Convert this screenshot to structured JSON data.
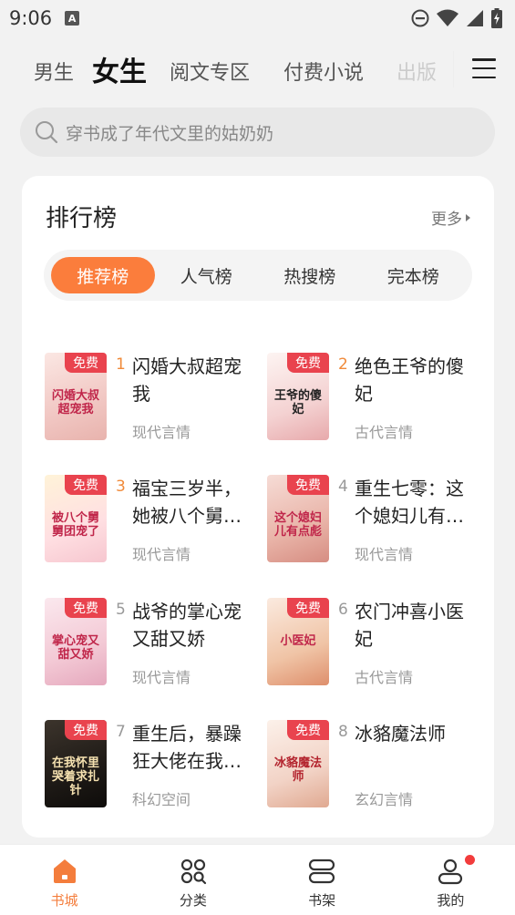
{
  "status_bar": {
    "time": "9:06",
    "notification_letter": "A"
  },
  "top_tabs": [
    {
      "label": "男生",
      "state": "normal"
    },
    {
      "label": "女生",
      "state": "active"
    },
    {
      "label": "阅文专区",
      "state": "normal"
    },
    {
      "label": "付费小说",
      "state": "normal"
    },
    {
      "label": "出版",
      "state": "faded"
    }
  ],
  "search": {
    "placeholder": "穿书成了年代文里的姑奶奶"
  },
  "ranking": {
    "title": "排行榜",
    "more_label": "更多",
    "tabs": [
      "推荐榜",
      "人气榜",
      "热搜榜",
      "完本榜"
    ],
    "books": [
      {
        "rank": "1",
        "title": "闪婚大叔超宠我",
        "genre": "现代言情",
        "badge": "免费",
        "cover_text": "闪婚大叔超宠我"
      },
      {
        "rank": "2",
        "title": "绝色王爷的傻妃",
        "genre": "古代言情",
        "badge": "免费",
        "cover_text": "王爷的傻妃"
      },
      {
        "rank": "3",
        "title": "福宝三岁半，她被八个舅舅团宠了",
        "genre": "现代言情",
        "badge": "免费",
        "cover_text": "被八个舅舅团宠了"
      },
      {
        "rank": "4",
        "title": "重生七零：这个媳妇儿有点彪",
        "genre": "现代言情",
        "badge": "免费",
        "cover_text": "这个媳妇儿有点彪"
      },
      {
        "rank": "5",
        "title": "战爷的掌心宠又甜又娇",
        "genre": "现代言情",
        "badge": "免费",
        "cover_text": "掌心宠又甜又娇"
      },
      {
        "rank": "6",
        "title": "农门冲喜小医妃",
        "genre": "古代言情",
        "badge": "免费",
        "cover_text": "小医妃"
      },
      {
        "rank": "7",
        "title": "重生后，暴躁狂大佬在我怀里哭着求扎针",
        "genre": "科幻空间",
        "badge": "免费",
        "cover_text": "在我怀里哭着求扎针"
      },
      {
        "rank": "8",
        "title": "冰貉魔法师",
        "genre": "玄幻言情",
        "badge": "免费",
        "cover_text": "冰貉魔法师"
      }
    ]
  },
  "bottom_nav": [
    {
      "label": "书城",
      "icon": "bookstore-icon",
      "active": true
    },
    {
      "label": "分类",
      "icon": "category-icon",
      "active": false
    },
    {
      "label": "书架",
      "icon": "bookshelf-icon",
      "active": false
    },
    {
      "label": "我的",
      "icon": "profile-icon",
      "active": false,
      "has_dot": true
    }
  ],
  "colors": {
    "accent": "#fb7d3c",
    "badge": "#e9434e",
    "dot": "#f23c3c"
  }
}
